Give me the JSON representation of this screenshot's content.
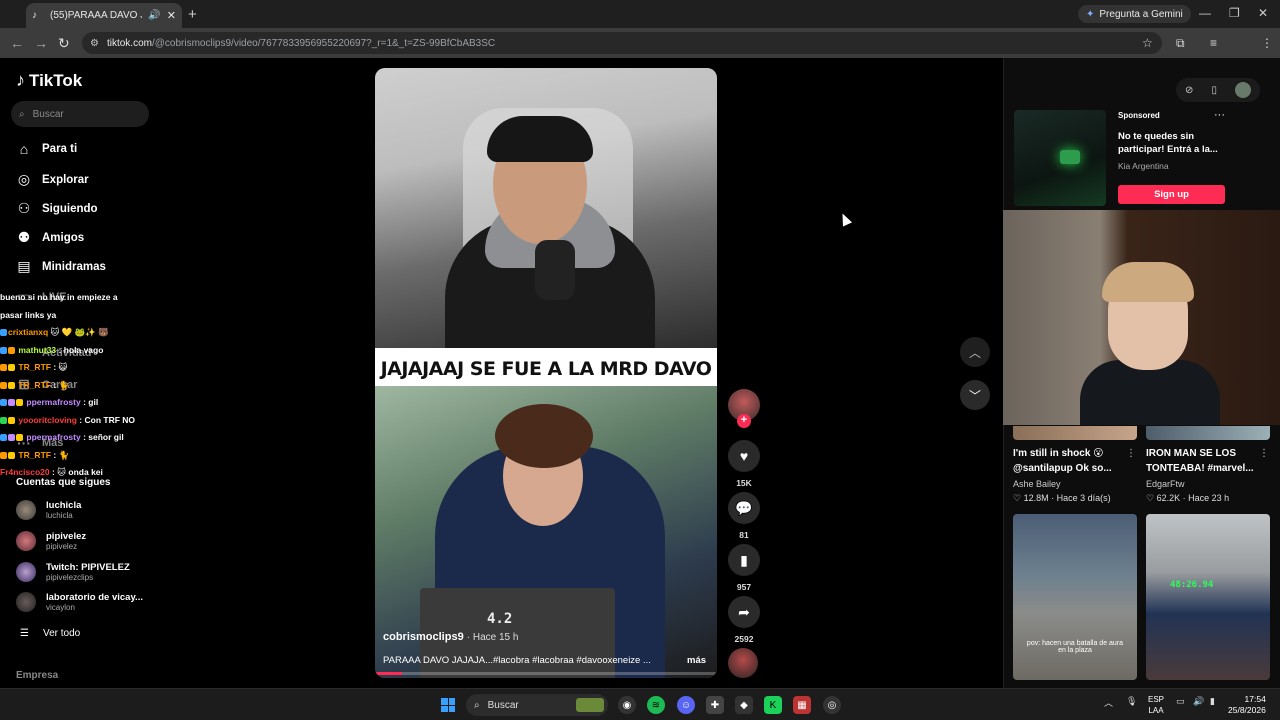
{
  "browser": {
    "tab_title": "(55)PARAAA DAVO JAJAJA",
    "gemini_label": "Pregunta a Gemini",
    "url_host": "tiktok.com",
    "url_path": "/@cobrismoclips9/video/7677833956955220697?_r=1&_t=ZS-99BfCbAB3SC"
  },
  "tiktok": {
    "logo": "TikTok",
    "search_placeholder": "Buscar",
    "nav": [
      {
        "label": "Para ti",
        "icon": "home-icon"
      },
      {
        "label": "Explorar",
        "icon": "compass-icon"
      },
      {
        "label": "Siguiendo",
        "icon": "following-icon"
      },
      {
        "label": "Amigos",
        "icon": "friends-icon"
      },
      {
        "label": "Minidramas",
        "icon": "film-icon"
      },
      {
        "label": "LIVE",
        "icon": "live-icon"
      },
      {
        "label": "Actividad",
        "icon": "bell-icon"
      },
      {
        "label": "Cargar",
        "icon": "upload-icon"
      },
      {
        "label": "Más",
        "icon": "more-icon"
      }
    ],
    "following_title": "Cuentas que sigues",
    "accounts": [
      {
        "name": "luchicla",
        "handle": "luchicla"
      },
      {
        "name": "pipivelez",
        "handle": "pipivelez"
      },
      {
        "name": "Twitch: PIPIVELEZ",
        "handle": "pipivelezclips"
      },
      {
        "name": "laboratorio de vicay...",
        "handle": "vicaylon"
      }
    ],
    "ver_todo": "Ver todo",
    "empresa": "Empresa"
  },
  "chat": [
    {
      "user": "",
      "msg": "bueno si no hay in empieze a",
      "color": "#ffffff"
    },
    {
      "user": "",
      "msg": "pasar links ya",
      "color": "#ffffff"
    },
    {
      "user": "crixtianxq",
      "msg": "",
      "color": "#ff9900"
    },
    {
      "user": "mathut33",
      "msg": "hola vago",
      "color": "#b7ff3c"
    },
    {
      "user": "TR_RTF",
      "msg": "",
      "color": "#ff9900"
    },
    {
      "user": "TR_RTF",
      "msg": "",
      "color": "#ff9900"
    },
    {
      "user": "ppermafrosty",
      "msg": "gil",
      "color": "#c38bff"
    },
    {
      "user": "yoooritcloving",
      "msg": "Con TRF NO",
      "color": "#ff3b3b"
    },
    {
      "user": "ppermafrosty",
      "msg": "señor gil",
      "color": "#c38bff"
    },
    {
      "user": "TR_RTF",
      "msg": "",
      "color": "#ff9900"
    },
    {
      "user": "Fr4ncisco20",
      "msg": "onda kei",
      "color": "#ff3b3b"
    }
  ],
  "video": {
    "banner": "JAJAJAAJ SE FUE A LA MRD DAVO",
    "laptop_label": "4.2",
    "author": "cobrismoclips9",
    "time": "· Hace 15 h",
    "description": "PARAAA DAVO JAJAJA...#lacobra #lacobraa #davooxeneize ...",
    "more": "más",
    "progress": 0.08,
    "likes": "15K",
    "comments": "81",
    "saves": "957",
    "shares": "2592"
  },
  "ad": {
    "sponsored": "Sponsored",
    "title": "No te quedes sin participar! Entrá a la...",
    "brand": "Kia Argentina",
    "cta": "Sign up"
  },
  "cards": [
    {
      "title": "I'm still in shock 😮 @santilapup Ok so...",
      "author": "Ashe Bailey",
      "meta": "♡ 12.8M · Hace 3 día(s)"
    },
    {
      "title": "IRON MAN SE LOS TONTEABA! #marvel...",
      "author": "EdgarFtw",
      "meta": "♡ 62.2K · Hace 23 h"
    }
  ],
  "thumbs": {
    "caption": "pov: hacen una batalla de aura en la plaza",
    "timer": "48:26.94"
  },
  "taskbar": {
    "search": "Buscar",
    "lang_top": "ESP",
    "lang_bottom": "LAA",
    "time": "17:54",
    "date": "25/8/2026"
  }
}
